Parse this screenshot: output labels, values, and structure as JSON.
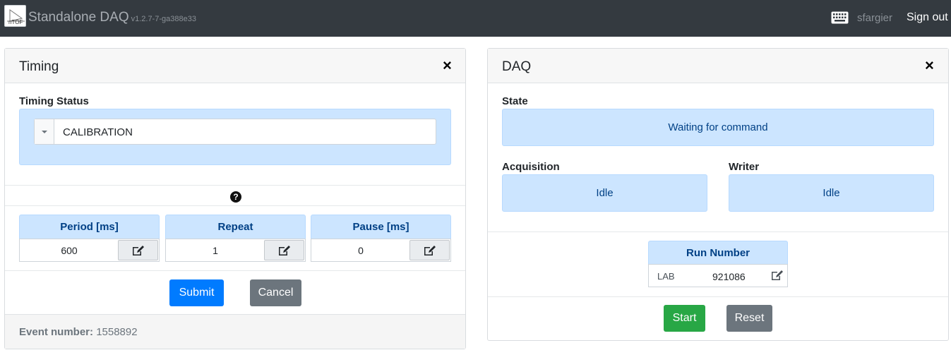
{
  "navbar": {
    "logo_text": "nTOF",
    "app_title": "Standalone DAQ",
    "version": "v1.2.7-7-ga388e33",
    "username": "sfargier",
    "signout_label": "Sign out",
    "icons": [
      "keyboard-icon"
    ]
  },
  "timing": {
    "title": "Timing",
    "close_label": "×",
    "status_label": "Timing Status",
    "status_value": "CALIBRATION",
    "help_label": "?",
    "params": [
      {
        "label": "Period [ms]",
        "value": "600"
      },
      {
        "label": "Repeat",
        "value": "1"
      },
      {
        "label": "Pause [ms]",
        "value": "0"
      }
    ],
    "submit_label": "Submit",
    "cancel_label": "Cancel",
    "event_label": "Event number:",
    "event_value": "1558892"
  },
  "daq": {
    "title": "DAQ",
    "close_label": "×",
    "state_label": "State",
    "state_value": "Waiting for command",
    "acquisition_label": "Acquisition",
    "acquisition_value": "Idle",
    "writer_label": "Writer",
    "writer_value": "Idle",
    "run_number_label": "Run Number",
    "run_prefix": "LAB",
    "run_value": "921086",
    "start_label": "Start",
    "reset_label": "Reset"
  },
  "colors": {
    "navbar": "#343a40",
    "info_bg": "#cce5ff",
    "info_text": "#004085",
    "primary": "#007bff",
    "secondary": "#6c757d",
    "success": "#28a745"
  }
}
